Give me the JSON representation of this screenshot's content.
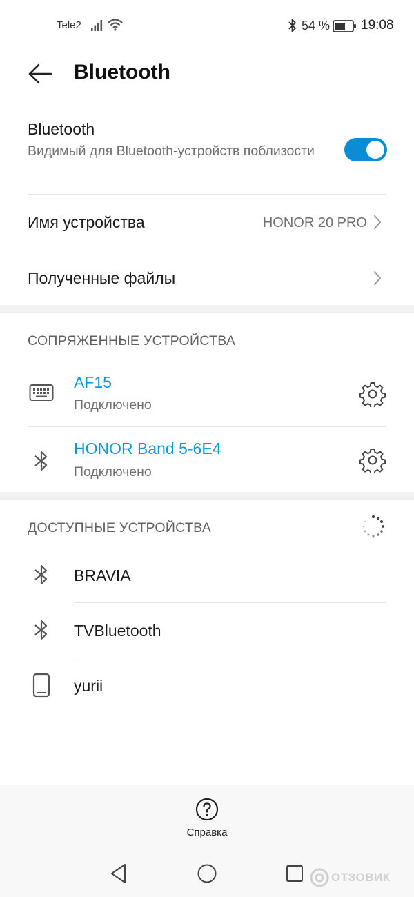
{
  "status_bar": {
    "carrier": "Tele2",
    "battery_percent": "54 %",
    "time": "19:08",
    "icons": [
      "signal-icon",
      "wifi-icon",
      "bluetooth-icon",
      "battery-icon"
    ]
  },
  "header": {
    "title": "Bluetooth"
  },
  "bluetooth_toggle": {
    "title": "Bluetooth",
    "subtitle": "Видимый для Bluetooth-устройств поблизости",
    "enabled": true
  },
  "device_name": {
    "label": "Имя устройства",
    "value": "HONOR 20 PRO"
  },
  "received_files": {
    "label": "Полученные файлы"
  },
  "paired": {
    "header": "СОПРЯЖЕННЫЕ УСТРОЙСТВА",
    "devices": [
      {
        "name": "AF15",
        "status": "Подключено",
        "icon": "keyboard-icon"
      },
      {
        "name": "HONOR Band 5-6E4",
        "status": "Подключено",
        "icon": "bluetooth-icon"
      }
    ]
  },
  "available": {
    "header": "ДОСТУПНЫЕ УСТРОЙСТВА",
    "devices": [
      {
        "name": "BRAVIA",
        "icon": "bluetooth-icon"
      },
      {
        "name": "TVBluetooth",
        "icon": "bluetooth-icon"
      },
      {
        "name": "yurii",
        "icon": "phone-icon"
      }
    ]
  },
  "help": {
    "label": "Справка"
  },
  "watermark": "ОТЗОВИК",
  "colors": {
    "accent": "#0a8cd6",
    "link": "#0a9ad8",
    "section_gap": "#f1f1f1"
  }
}
